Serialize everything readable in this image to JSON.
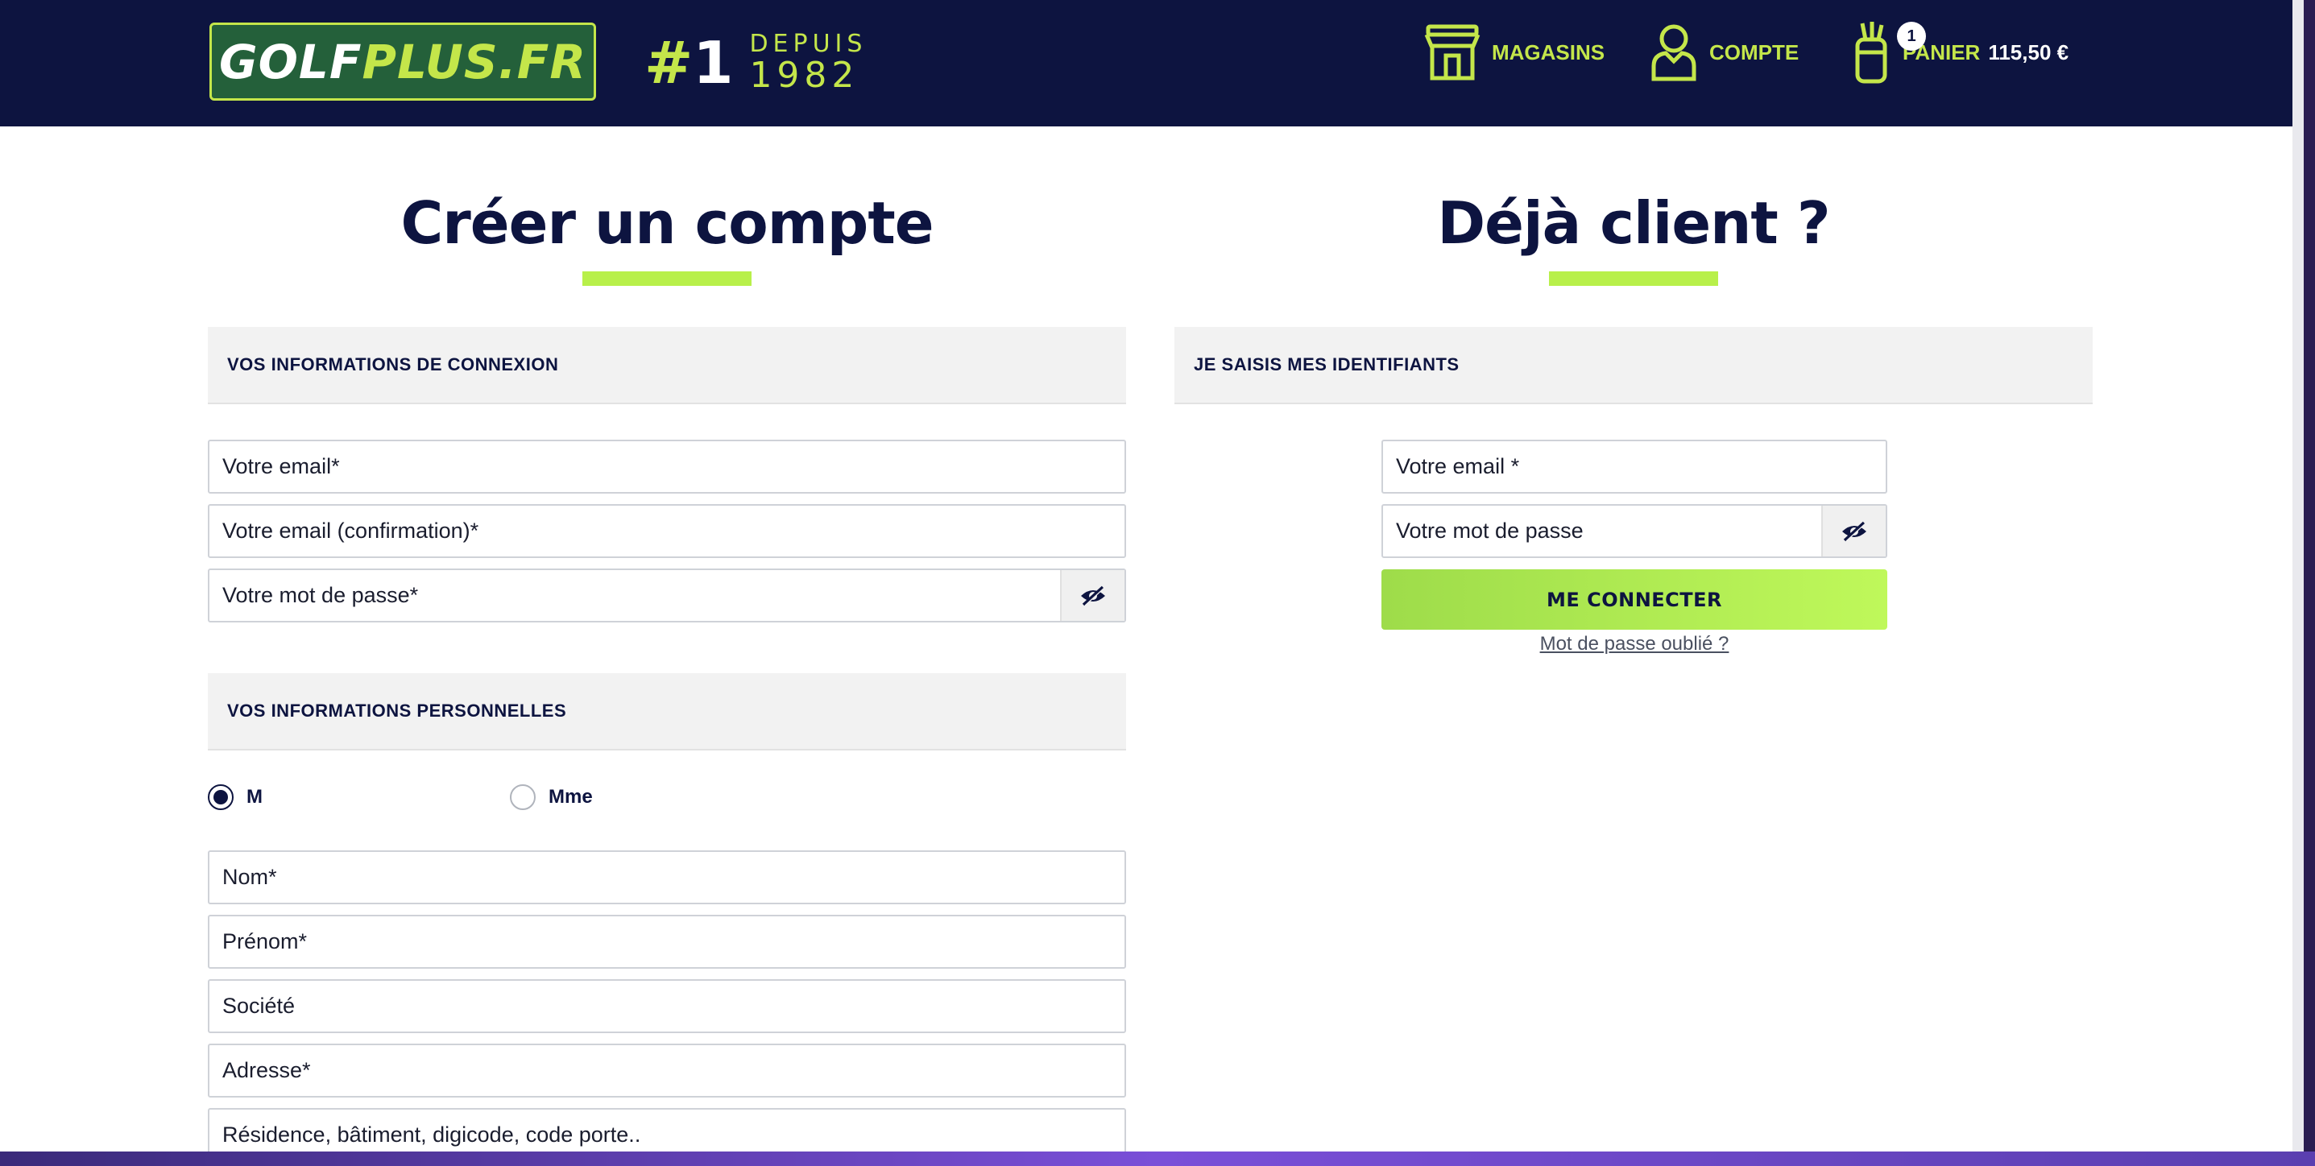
{
  "header": {
    "logo": {
      "part1": "GOLF",
      "part2": "PLUS.FR"
    },
    "tagline": {
      "rank": "#",
      "rank_number": "1",
      "since": "DEPUIS",
      "year": "1982"
    },
    "nav": {
      "stores_label": "MAGASINS",
      "account_label": "COMPTE",
      "cart_label": "PANIER",
      "cart_amount": "115,50 €",
      "cart_count": "1"
    },
    "colors": {
      "navy": "#0d1440",
      "lime": "#c4e64a"
    },
    "icons": {
      "stores": "store-icon",
      "account": "user-icon",
      "cart": "golf-bag-icon"
    }
  },
  "register": {
    "title": "Créer un compte",
    "login_info_heading": "VOS INFORMATIONS DE CONNEXION",
    "email_placeholder": "Votre email*",
    "email_confirm_placeholder": "Votre email (confirmation)*",
    "password_placeholder": "Votre mot de passe*",
    "personal_info_heading": "VOS INFORMATIONS PERSONNELLES",
    "civility": {
      "option_m": "M",
      "option_mme": "Mme",
      "selected": "M"
    },
    "lastname_placeholder": "Nom*",
    "firstname_placeholder": "Prénom*",
    "company_placeholder": "Société",
    "address_placeholder": "Adresse*",
    "address2_placeholder": "Résidence, bâtiment, digicode, code porte.."
  },
  "login": {
    "title": "Déjà client ?",
    "heading": "JE SAISIS MES IDENTIFIANTS",
    "email_placeholder": "Votre email *",
    "password_placeholder": "Votre mot de passe",
    "submit_label": "ME CONNECTER",
    "forgot_label": "Mot de passe oublié ?"
  }
}
